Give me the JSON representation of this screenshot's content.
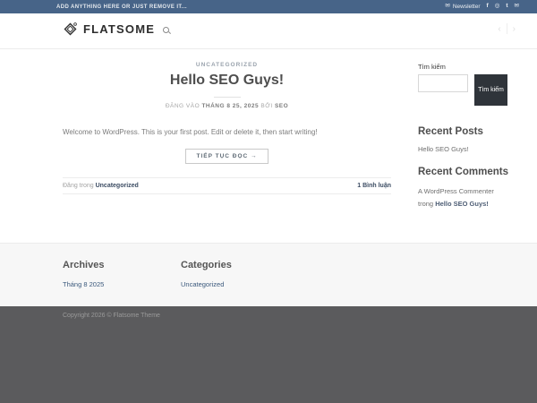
{
  "topbar": {
    "left_text": "ADD ANYTHING HERE OR JUST REMOVE IT...",
    "newsletter_label": "Newsletter"
  },
  "icons": {
    "newsletter": "✉",
    "facebook": "f",
    "instagram": "◎",
    "twitter": "t",
    "email": "✉"
  },
  "header": {
    "logo_text": "FLATSOME",
    "prev_arrow": "‹",
    "next_arrow": "›"
  },
  "post": {
    "category": "UNCATEGORIZED",
    "title": "Hello SEO Guys!",
    "meta_prefix": "ĐĂNG VÀO",
    "meta_date": "THÁNG 8 25, 2025",
    "meta_by": "BỞI",
    "meta_author": "SEO",
    "excerpt": "Welcome to WordPress. This is your first post. Edit or delete it, then start writing!",
    "read_more": "TIẾP TỤC ĐỌC →",
    "posted_in_label": "Đăng trong",
    "posted_in_category": "Uncategorized",
    "comments_link": "1 Bình luận"
  },
  "sidebar": {
    "search_label": "Tìm kiếm",
    "search_button": "Tìm kiếm",
    "recent_posts_title": "Recent Posts",
    "recent_posts": [
      "Hello SEO Guys!"
    ],
    "recent_comments_title": "Recent Comments",
    "recent_comment_author": "A WordPress Commenter",
    "recent_comment_in": "trong",
    "recent_comment_post": "Hello SEO Guys!"
  },
  "footer": {
    "archives_title": "Archives",
    "archives_link": "Tháng 8 2025",
    "categories_title": "Categories",
    "categories_link": "Uncategorized",
    "copyright": "Copyright 2026 © Flatsome Theme"
  },
  "colors": {
    "topbar_bg": "#476488",
    "dark_footer_bg": "#5b5b5d",
    "accent": "#3c5a7d",
    "search_button_bg": "#2f343a"
  }
}
